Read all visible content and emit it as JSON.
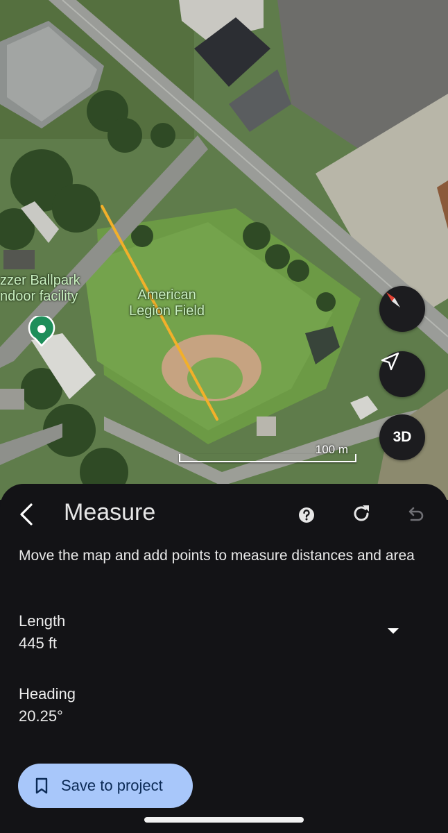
{
  "map": {
    "labels": {
      "ballpark_line1": "zzer Ballpark",
      "ballpark_line2": "ndoor facility",
      "field_line1": "American",
      "field_line2": "Legion Field"
    },
    "scale_label": "100 m",
    "controls": {
      "three_d_label": "3D"
    },
    "measure_line_color": "#f2b02a"
  },
  "sheet": {
    "title": "Measure",
    "description": "Move the map and add points to measure distances and area",
    "length_label": "Length",
    "length_value": "445 ft",
    "heading_label": "Heading",
    "heading_value": "20.25°",
    "save_button_label": "Save to project"
  },
  "colors": {
    "sheet_background": "#131316",
    "save_button": "#a8c7fa",
    "pin": "#1e8e5a"
  }
}
